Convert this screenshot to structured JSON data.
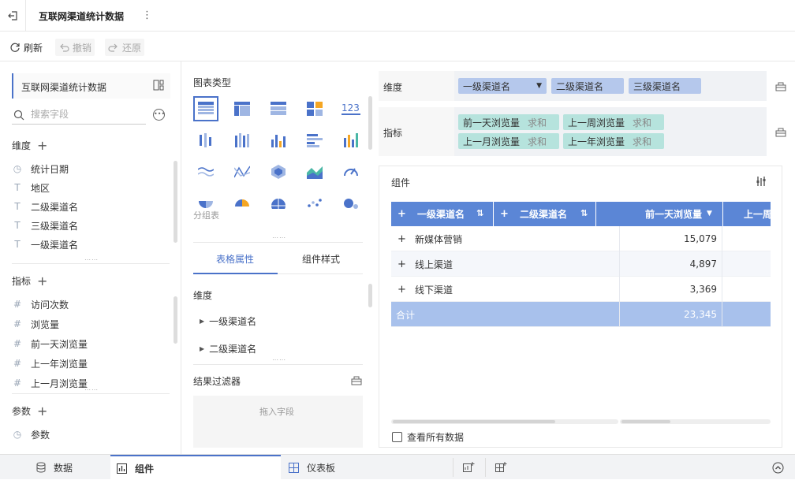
{
  "app": {
    "title": "互联网渠道统计数据",
    "more": "⋮"
  },
  "toolbar": {
    "refresh": "刷新",
    "undo": "撤销",
    "redo": "还原"
  },
  "left": {
    "dataset": "互联网渠道统计数据",
    "search_placeholder": "搜索字段",
    "dimension_title": "维度",
    "dimensions": [
      {
        "type": "date",
        "label": "统计日期"
      },
      {
        "type": "text",
        "label": "地区"
      },
      {
        "type": "text",
        "label": "二级渠道名"
      },
      {
        "type": "text",
        "label": "三级渠道名"
      },
      {
        "type": "text",
        "label": "一级渠道名"
      }
    ],
    "measure_title": "指标",
    "measures": [
      "访问次数",
      "浏览量",
      "前一天浏览量",
      "上一年浏览量",
      "上一月浏览量"
    ],
    "param_title": "参数",
    "params": [
      "参数"
    ]
  },
  "middle": {
    "chart_type_title": "图表类型",
    "group_table_label": "分组表",
    "tabs": [
      "表格属性",
      "组件样式"
    ],
    "dim_title": "维度",
    "tree": [
      "一级渠道名",
      "二级渠道名"
    ],
    "filter_title": "结果过滤器",
    "drop_placeholder": "拖入字段"
  },
  "shelves": {
    "dim_label": "维度",
    "dims": [
      "一级渠道名",
      "二级渠道名",
      "三级渠道名"
    ],
    "mea_label": "指标",
    "measures": [
      {
        "name": "前一天浏览量",
        "agg": "求和"
      },
      {
        "name": "上一周浏览量",
        "agg": "求和"
      },
      {
        "name": "上一月浏览量",
        "agg": "求和"
      },
      {
        "name": "上一年浏览量",
        "agg": "求和"
      }
    ]
  },
  "component": {
    "title": "组件",
    "headers": [
      "一级渠道名",
      "二级渠道名",
      "前一天浏览量",
      "上一周"
    ],
    "rows": [
      {
        "name": "新媒体营销",
        "value": "15,079"
      },
      {
        "name": "线上渠道",
        "value": "4,897"
      },
      {
        "name": "线下渠道",
        "value": "3,369"
      }
    ],
    "total": {
      "label": "合计",
      "value": "23,345"
    },
    "show_all": "查看所有数据"
  },
  "bottom": {
    "tabs": [
      "数据",
      "组件",
      "仪表板"
    ]
  },
  "colors": {
    "accent": "#4a72c9",
    "header": "#5b86d6",
    "total": "#a8c1ec",
    "dim_pill": "#b5c8ec",
    "measure_pill": "#b6e3dd"
  }
}
